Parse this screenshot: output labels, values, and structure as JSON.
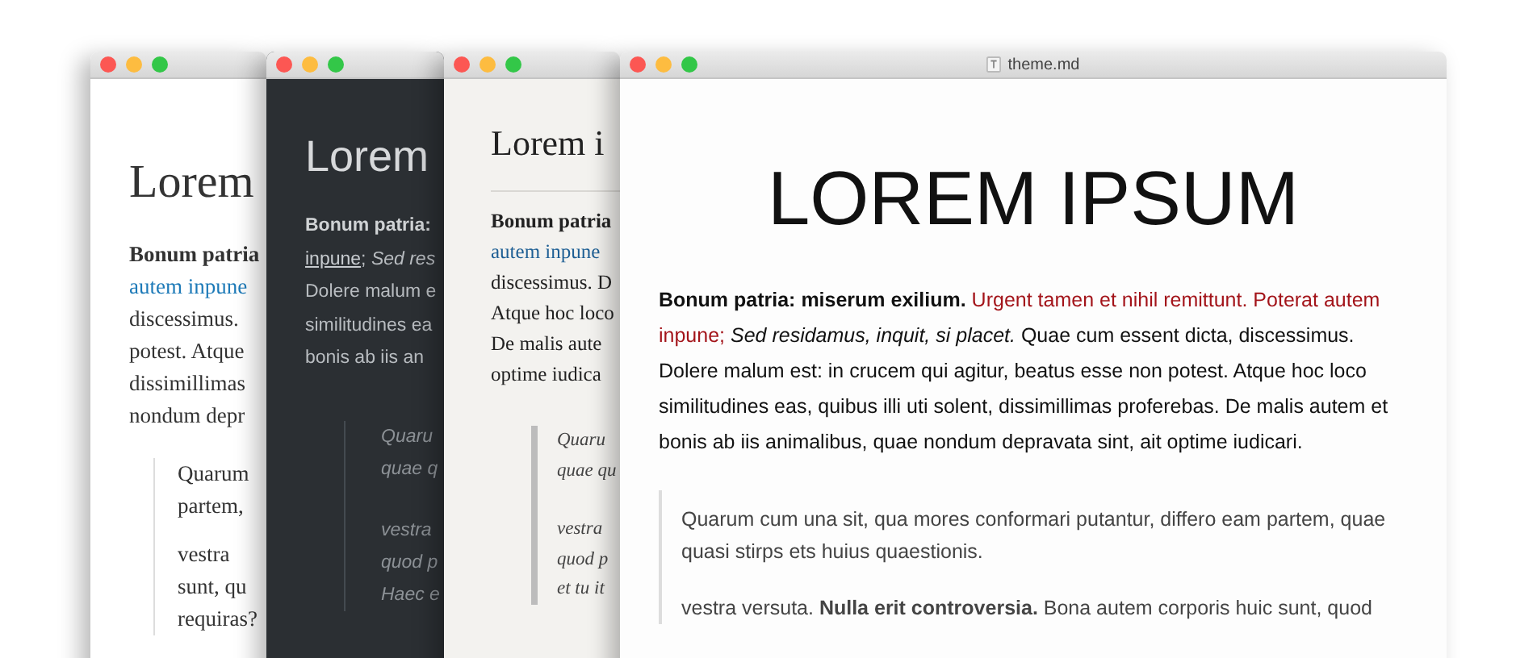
{
  "windows": [
    {
      "kind": "serif",
      "heading": "Lorem",
      "lines": [
        [
          {
            "kind": "bold",
            "text": "Bonum patria"
          }
        ],
        [
          {
            "kind": "link",
            "text": "autem inpune"
          }
        ],
        [
          {
            "kind": "plain",
            "text": "discessimus."
          }
        ],
        [
          {
            "kind": "plain",
            "text": "potest. Atque"
          }
        ],
        [
          {
            "kind": "plain",
            "text": "dissimillimas"
          }
        ],
        [
          {
            "kind": "plain",
            "text": "nondum depr"
          }
        ]
      ],
      "quote": [
        [
          "Quarum",
          "partem,"
        ],
        [
          "vestra",
          "sunt, qu",
          "requiras?"
        ]
      ]
    },
    {
      "kind": "dark",
      "heading": "Lorem",
      "lines": [
        [
          {
            "kind": "bold",
            "text": "Bonum patria:"
          }
        ],
        [
          {
            "kind": "link",
            "text": "inpune"
          },
          {
            "kind": "plain",
            "text": "; "
          },
          {
            "kind": "italic",
            "text": "Sed res"
          }
        ],
        [
          {
            "kind": "plain",
            "text": "Dolere malum e"
          }
        ],
        [
          {
            "kind": "plain",
            "text": "similitudines ea"
          }
        ],
        [
          {
            "kind": "plain",
            "text": "bonis ab iis an"
          }
        ]
      ],
      "quote": [
        [
          "Quaru",
          "quae q"
        ],
        [
          "vestra",
          "quod p",
          "Haec e"
        ]
      ]
    },
    {
      "kind": "paper",
      "heading": "Lorem i",
      "lines": [
        [
          {
            "kind": "bold",
            "text": "Bonum patria"
          }
        ],
        [
          {
            "kind": "link",
            "text": "autem inpune"
          }
        ],
        [
          {
            "kind": "plain",
            "text": "discessimus. D"
          }
        ],
        [
          {
            "kind": "plain",
            "text": "Atque hoc loco"
          }
        ],
        [
          {
            "kind": "plain",
            "text": "De malis aute"
          }
        ],
        [
          {
            "kind": "plain",
            "text": "optime iudica"
          }
        ]
      ],
      "quote": [
        [
          "Quaru",
          "quae qu"
        ],
        [
          "vestra",
          "quod p",
          "et tu it"
        ]
      ]
    },
    {
      "kind": "sans",
      "title": "theme.md",
      "heading": "LOREM IPSUM",
      "paragraph": [
        {
          "kind": "bold",
          "text": "Bonum patria: miserum exilium. "
        },
        {
          "kind": "accent",
          "text": "Urgent tamen et nihil remittunt. Poterat autem inpune; "
        },
        {
          "kind": "italic",
          "text": "Sed residamus, inquit, si placet."
        },
        {
          "kind": "plain",
          "text": " Quae cum essent dicta, discessimus. Dolere malum est: in crucem qui agitur, beatus esse non potest. Atque hoc loco similitudines eas, quibus illi uti solent, dissimillimas proferebas. De malis autem et bonis ab iis animalibus, quae nondum depravata sint, ait optime iudicari."
        }
      ],
      "quote": [
        "Quarum cum una sit, qua mores conformari putantur, differo eam partem, quae quasi stirps ets huius quaestionis.",
        "vestra versuta. **Nulla erit controversia.** Bona autem corporis huic sunt, quod"
      ]
    }
  ]
}
